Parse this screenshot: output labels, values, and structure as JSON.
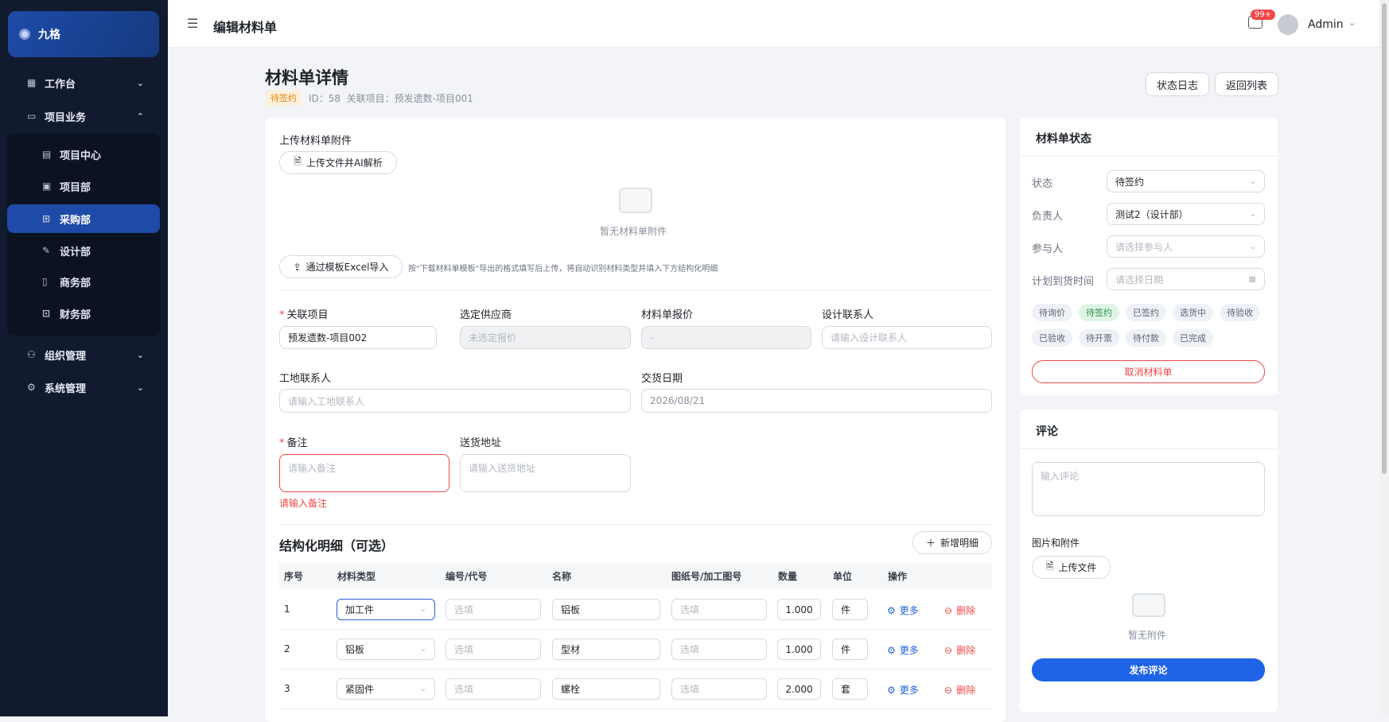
{
  "brand": "九格",
  "sidebar": {
    "items": [
      {
        "label": "工作台",
        "icon": "grid-icon"
      },
      {
        "label": "项目业务",
        "icon": "folder-icon"
      },
      {
        "label": "组织管理",
        "icon": "org-icon"
      },
      {
        "label": "系统管理",
        "icon": "gear-icon"
      }
    ],
    "sub": [
      {
        "label": "项目中心",
        "icon": "building-icon"
      },
      {
        "label": "项目部",
        "icon": "clipboard-icon"
      },
      {
        "label": "采购部",
        "icon": "cart-icon",
        "active": true
      },
      {
        "label": "设计部",
        "icon": "pen-icon"
      },
      {
        "label": "商务部",
        "icon": "doc-icon"
      },
      {
        "label": "财务部",
        "icon": "wallet-icon"
      }
    ]
  },
  "topbar": {
    "title": "编辑材料单",
    "badge": "99+",
    "user": "Admin"
  },
  "page": {
    "title": "材料单详情",
    "status_tag": "待签约",
    "meta": "ID：58  关联项目：预发遗数-项目001",
    "btn_log": "状态日志",
    "btn_back": "返回列表"
  },
  "form": {
    "attach_label": "上传材料单附件",
    "upload_btn": "上传文件并AI解析",
    "empty_attach": "暂无材料单附件",
    "import_btn": "通过模板Excel导入",
    "import_hint": "按\"下载材料单模板\"导出的格式填写后上传，将自动识别材料类型并填入下方结构化明细",
    "project_label": "关联项目",
    "project_value": "预发遗数-项目002",
    "supplier_label": "选定供应商",
    "supplier_ph": "未选定报价",
    "quote_label": "材料单报价",
    "quote_ph": "-",
    "designer_label": "设计联系人",
    "designer_ph": "请输入设计联系人",
    "site_label": "工地联系人",
    "site_ph": "请输入工地联系人",
    "date_label": "交货日期",
    "date_value": "2026/08/21",
    "remark_label": "备注",
    "remark_ph": "请输入备注",
    "remark_error": "请输入备注",
    "address_label": "送货地址",
    "address_ph": "请输入送货地址"
  },
  "detail": {
    "title": "结构化明细（可选）",
    "add_btn": "新增明细",
    "headers": [
      "序号",
      "材料类型",
      "编号/代号",
      "名称",
      "图纸号/加工图号",
      "数量",
      "单位",
      "操作"
    ],
    "rows": [
      {
        "no": "1",
        "type": "加工件",
        "code": "选填",
        "name": "铝板",
        "drawing": "选填",
        "qty": "1.000",
        "unit": "件",
        "more": "更多",
        "del": "删除"
      },
      {
        "no": "2",
        "type": "铝板",
        "code": "选填",
        "name": "型材",
        "drawing": "选填",
        "qty": "1.000",
        "unit": "件",
        "more": "更多",
        "del": "删除"
      },
      {
        "no": "3",
        "type": "紧固件",
        "code": "选填",
        "name": "螺栓",
        "drawing": "选填",
        "qty": "2.000",
        "unit": "套",
        "more": "更多",
        "del": "删除"
      }
    ]
  },
  "status_panel": {
    "title": "材料单状态",
    "state_label": "状态",
    "state_value": "待签约",
    "owner_label": "负责人",
    "owner_value": "测试2（设计部）",
    "part_label": "参与人",
    "part_ph": "请选择参与人",
    "plan_label": "计划到货时间",
    "plan_ph": "请选择日期",
    "tags": [
      "待询价",
      "待签约",
      "已签约",
      "选货中",
      "待验收",
      "已验收",
      "待开票",
      "待付款",
      "已完成"
    ],
    "active_tag": "待签约",
    "cancel_btn": "取消材料单"
  },
  "comment": {
    "title": "评论",
    "ph": "输入评论",
    "files_label": "图片和附件",
    "upload_btn": "上传文件",
    "empty": "暂无附件",
    "publish_btn": "发布评论"
  },
  "colors": {
    "accent": "#1f64e6",
    "sidebar": "#111a2e",
    "danger": "#f04848",
    "success": "#2a8f4e",
    "tag_orange": "#e8860c"
  }
}
